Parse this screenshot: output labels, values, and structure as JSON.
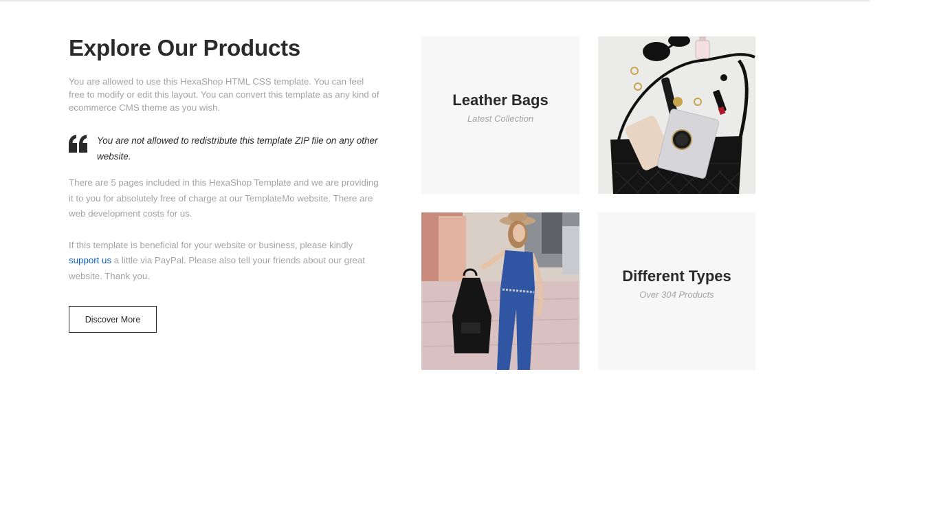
{
  "section": {
    "title": "Explore Our Products",
    "intro": "You are allowed to use this HexaShop HTML CSS template. You can feel free to modify or edit this layout. You can convert this template as any kind of ecommerce CMS theme as you wish.",
    "quote": "You are not allowed to redistribute this template ZIP file on any other website.",
    "pages_note": "There are 5 pages included in this HexaShop Template and we are providing it to you for absolutely free of charge at our TemplateMo website. There are web development costs for us.",
    "support_before": "If this template is beneficial for your website or business, please kindly ",
    "support_link": "support us",
    "support_after": " a little via PayPal. Please also tell your friends about our great website. Thank you.",
    "button_label": "Discover More"
  },
  "tiles": {
    "leather": {
      "title": "Leather Bags",
      "subtitle": "Latest Collection"
    },
    "types": {
      "title": "Different Types",
      "subtitle": "Over 304 Products"
    }
  },
  "colors": {
    "heading": "#2a2a2a",
    "body_text": "#a3a3a3",
    "link": "#0c5fcd",
    "tile_background": "#f7f7f7"
  },
  "icons": {
    "quote": "quote-left-icon"
  }
}
